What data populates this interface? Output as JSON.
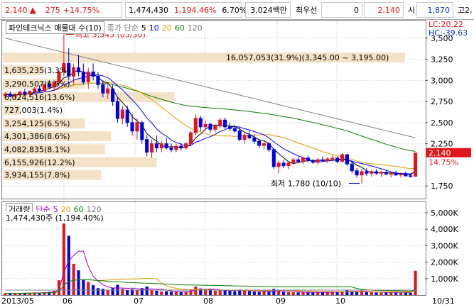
{
  "quote": {
    "price": "2,140",
    "change": "275",
    "change_pct": "+14.75%",
    "volume": "1,474,430",
    "volume_pct": "1,194.46%",
    "turnover_pct": "6.70%",
    "amount": "3,024백만",
    "pref_label": "최우선",
    "pref_value": "0",
    "last": "2,140",
    "low_label": "시",
    "open": "1,870",
    "high_label": "고",
    "high_value": "2,"
  },
  "legend_price": {
    "name": "파인테크닉스 매물대 수(10)",
    "ma_label": "종가 단순",
    "ma": [
      "5",
      "10",
      "20",
      "60",
      "120"
    ]
  },
  "legend_vol": {
    "name": "거래량",
    "ma_label": "단순",
    "ma": [
      "5",
      "20",
      "60",
      "120"
    ],
    "value_text": "1,474,430주 (1,194.40%)"
  },
  "lc_hc": {
    "lc": "LC:20.22",
    "hc": "HC:-39.63"
  },
  "colors": {
    "up": "#e0161a",
    "down": "#0000e0",
    "ma5": "#000000",
    "ma10": "#0000ff",
    "ma20": "#e39a00",
    "ma60": "#008000",
    "ma120": "#808080",
    "vol_ma5": "#9900cc",
    "vol_ma20": "#e39a00",
    "vol_ma60": "#008000",
    "vol_ma120": "#808080",
    "profile": "#f3e2c7"
  },
  "chart_data": [
    {
      "type": "candlestick",
      "title": "파인테크닉스",
      "x_ticks": [
        "2013/05",
        "06",
        "07",
        "08",
        "09",
        "10",
        "10/31"
      ],
      "y_ticks": [
        "3,500",
        "3,250",
        "3,000",
        "2,750",
        "2,500",
        "2,250",
        "1,750"
      ],
      "ylim": [
        1600,
        3700
      ],
      "current_price_label": "2,140",
      "current_pct_label": "14.75%",
      "annotations": {
        "high": "최고 3,545 (05/30)",
        "low": "최저 1,780 (10/10)",
        "band": "16,057,053(31.9%)(3,345.00 ~ 3,195.00)"
      },
      "volume_profile": [
        {
          "label": "16,057,053(31.9%)(3,345.00 ~ 3,195.00)",
          "price": 3270,
          "pct": 31.9
        },
        {
          "label": "1,635,235(3.3%)",
          "price": 3120,
          "pct": 3.3
        },
        {
          "label": "3,290,507(6.5%)",
          "price": 2960,
          "pct": 6.5
        },
        {
          "label": "6,024,516(13.6%)",
          "price": 2800,
          "pct": 13.6
        },
        {
          "label": "727,003(1.4%)",
          "price": 2650,
          "pct": 1.4
        },
        {
          "label": "3,254,125(6.5%)",
          "price": 2490,
          "pct": 6.5
        },
        {
          "label": "4,301,386(8.6%)",
          "price": 2340,
          "pct": 8.6
        },
        {
          "label": "4,082,835(8.1%)",
          "price": 2185,
          "pct": 8.1
        },
        {
          "label": "6,155,926(12.2%)",
          "price": 2030,
          "pct": 12.2
        },
        {
          "label": "3,934,155(7.8%)",
          "price": 1880,
          "pct": 7.8
        }
      ],
      "ohlc": [
        [
          2820,
          2860,
          2790,
          2840
        ],
        [
          2840,
          2870,
          2800,
          2810
        ],
        [
          2810,
          2850,
          2780,
          2830
        ],
        [
          2830,
          2880,
          2810,
          2860
        ],
        [
          2860,
          2900,
          2820,
          2840
        ],
        [
          2840,
          2880,
          2800,
          2870
        ],
        [
          2870,
          2920,
          2840,
          2900
        ],
        [
          2900,
          2940,
          2860,
          2880
        ],
        [
          2880,
          2960,
          2860,
          2950
        ],
        [
          2950,
          3000,
          2900,
          2920
        ],
        [
          2920,
          3000,
          2880,
          2980
        ],
        [
          2980,
          3120,
          2950,
          3100
        ],
        [
          3100,
          3545,
          3050,
          3200
        ],
        [
          3200,
          3380,
          3000,
          3050
        ],
        [
          3050,
          3200,
          2950,
          3150
        ],
        [
          3150,
          3300,
          3050,
          3100
        ],
        [
          3100,
          3200,
          2950,
          2980
        ],
        [
          2980,
          3150,
          2900,
          3100
        ],
        [
          3100,
          3200,
          3000,
          3050
        ],
        [
          3050,
          3100,
          2900,
          2950
        ],
        [
          2950,
          3000,
          2800,
          2850
        ],
        [
          2850,
          2950,
          2780,
          2900
        ],
        [
          2900,
          2950,
          2700,
          2750
        ],
        [
          2750,
          2800,
          2500,
          2550
        ],
        [
          2550,
          2700,
          2480,
          2650
        ],
        [
          2650,
          2700,
          2450,
          2500
        ],
        [
          2500,
          2600,
          2350,
          2400
        ],
        [
          2400,
          2550,
          2300,
          2500
        ],
        [
          2500,
          2520,
          2250,
          2300
        ],
        [
          2300,
          2350,
          2100,
          2150
        ],
        [
          2150,
          2300,
          2080,
          2250
        ],
        [
          2250,
          2350,
          2150,
          2200
        ],
        [
          2200,
          2280,
          2150,
          2250
        ],
        [
          2250,
          2320,
          2180,
          2200
        ],
        [
          2200,
          2250,
          2150,
          2180
        ],
        [
          2180,
          2250,
          2150,
          2220
        ],
        [
          2220,
          2260,
          2170,
          2200
        ],
        [
          2200,
          2270,
          2180,
          2250
        ],
        [
          2250,
          2400,
          2230,
          2380
        ],
        [
          2380,
          2600,
          2350,
          2550
        ],
        [
          2550,
          2580,
          2400,
          2450
        ],
        [
          2450,
          2520,
          2400,
          2480
        ],
        [
          2480,
          2500,
          2380,
          2420
        ],
        [
          2420,
          2480,
          2390,
          2460
        ],
        [
          2460,
          2560,
          2440,
          2530
        ],
        [
          2530,
          2560,
          2430,
          2450
        ],
        [
          2450,
          2500,
          2400,
          2430
        ],
        [
          2430,
          2470,
          2380,
          2400
        ],
        [
          2400,
          2450,
          2280,
          2300
        ],
        [
          2300,
          2380,
          2250,
          2350
        ],
        [
          2350,
          2400,
          2300,
          2320
        ],
        [
          2320,
          2360,
          2250,
          2280
        ],
        [
          2280,
          2300,
          2200,
          2230
        ],
        [
          2230,
          2280,
          2180,
          2250
        ],
        [
          2250,
          2270,
          2150,
          2180
        ],
        [
          2180,
          2200,
          1950,
          1980
        ],
        [
          1980,
          2050,
          1900,
          2020
        ],
        [
          2020,
          2060,
          1960,
          1990
        ],
        [
          1990,
          2040,
          1950,
          2020
        ],
        [
          2020,
          2080,
          2000,
          2060
        ],
        [
          2060,
          2090,
          2020,
          2040
        ],
        [
          2040,
          2100,
          2010,
          2080
        ],
        [
          2080,
          2110,
          2030,
          2050
        ],
        [
          2050,
          2070,
          2010,
          2030
        ],
        [
          2030,
          2080,
          2000,
          2060
        ],
        [
          2060,
          2100,
          2030,
          2050
        ],
        [
          2050,
          2090,
          2020,
          2070
        ],
        [
          2070,
          2110,
          2040,
          2080
        ],
        [
          2080,
          2100,
          2020,
          2040
        ],
        [
          2040,
          2140,
          2030,
          2120
        ],
        [
          2120,
          2130,
          1990,
          2010
        ],
        [
          2010,
          2040,
          1900,
          1930
        ],
        [
          1930,
          1960,
          1850,
          1880
        ],
        [
          1880,
          1950,
          1780,
          1920
        ],
        [
          1920,
          1960,
          1870,
          1900
        ],
        [
          1900,
          1940,
          1860,
          1920
        ],
        [
          1920,
          1950,
          1880,
          1900
        ],
        [
          1900,
          1930,
          1860,
          1910
        ],
        [
          1910,
          1940,
          1880,
          1890
        ],
        [
          1890,
          1920,
          1850,
          1900
        ],
        [
          1900,
          1930,
          1870,
          1880
        ],
        [
          1880,
          1910,
          1850,
          1890
        ],
        [
          1890,
          1920,
          1860,
          1870
        ],
        [
          1870,
          1900,
          1850,
          1865
        ],
        [
          1865,
          2140,
          1860,
          2140
        ]
      ]
    },
    {
      "type": "bar",
      "title": "거래량",
      "y_ticks": [
        "5,000K",
        "4,000K",
        "3,000K",
        "2,000K",
        "1,000K"
      ],
      "ylim": [
        0,
        5600
      ],
      "unit": "K",
      "values_k": [
        110,
        90,
        100,
        130,
        120,
        140,
        160,
        110,
        180,
        200,
        260,
        900,
        5400,
        3600,
        1900,
        1500,
        950,
        800,
        600,
        420,
        380,
        300,
        450,
        620,
        380,
        300,
        350,
        280,
        420,
        520,
        300,
        260,
        220,
        240,
        200,
        190,
        180,
        210,
        350,
        520,
        400,
        300,
        280,
        260,
        330,
        300,
        260,
        240,
        330,
        280,
        250,
        220,
        200,
        230,
        210,
        380,
        260,
        200,
        180,
        170,
        160,
        180,
        170,
        150,
        160,
        170,
        180,
        200,
        190,
        230,
        280,
        240,
        210,
        260,
        180,
        170,
        160,
        150,
        170,
        160,
        150,
        140,
        150,
        140,
        1474
      ]
    }
  ]
}
